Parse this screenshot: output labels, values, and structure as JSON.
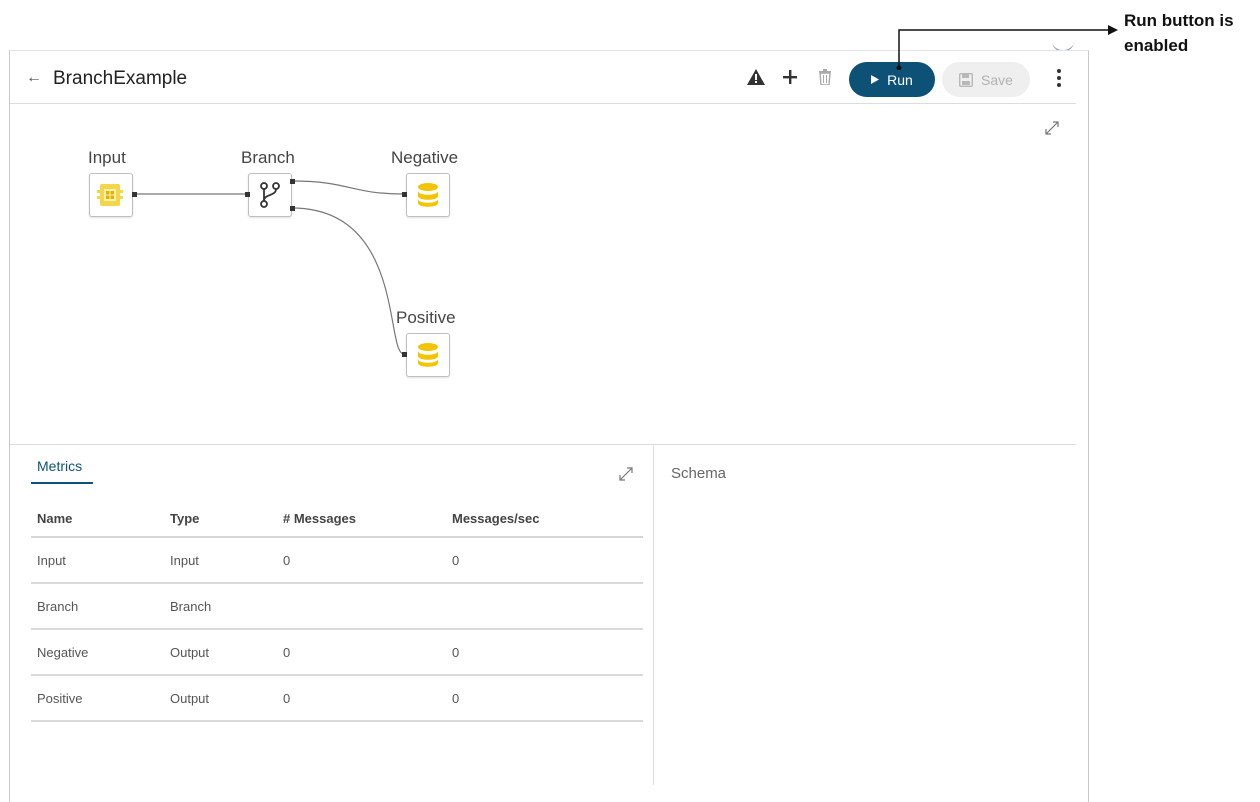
{
  "header": {
    "back_icon": "arrow-left-icon",
    "title": "BranchExample",
    "icons": [
      "warning-icon",
      "plus-icon",
      "trash-icon"
    ],
    "run_label": "Run",
    "save_label": "Save",
    "more_icon": "kebab-menu-icon"
  },
  "canvas": {
    "nodes": [
      {
        "label": "Input",
        "icon": "input-node-icon"
      },
      {
        "label": "Branch",
        "icon": "branch-icon"
      },
      {
        "label": "Negative",
        "icon": "database-icon"
      },
      {
        "label": "Positive",
        "icon": "database-icon"
      }
    ]
  },
  "metrics": {
    "tab_label": "Metrics",
    "columns": [
      "Name",
      "Type",
      "# Messages",
      "Messages/sec"
    ],
    "rows": [
      [
        "Input",
        "Input",
        "0",
        "0"
      ],
      [
        "Branch",
        "Branch",
        "",
        ""
      ],
      [
        "Negative",
        "Output",
        "0",
        "0"
      ],
      [
        "Positive",
        "Output",
        "0",
        "0"
      ]
    ]
  },
  "schema": {
    "title": "Schema"
  },
  "callout": {
    "text": "Run button is enabled"
  },
  "colors": {
    "run_button": "#0d5276",
    "node_icon_yellow": "#f2c500",
    "save_button_bg": "#efefef"
  }
}
